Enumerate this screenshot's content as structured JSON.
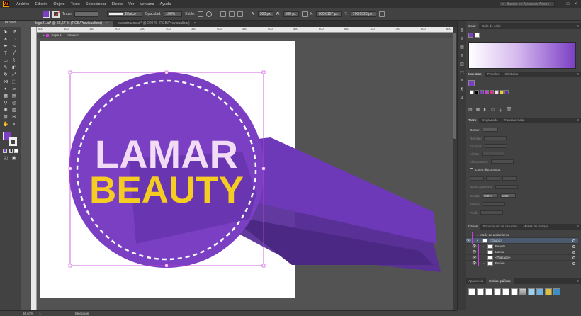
{
  "app": {
    "logo": "Ai"
  },
  "menu": [
    "Archivo",
    "Edición",
    "Objeto",
    "Texto",
    "Seleccionar",
    "Efecto",
    "Ver",
    "Ventana",
    "Ayuda"
  ],
  "search": {
    "placeholder": "Buscar en Ayuda de Adobe"
  },
  "controlbar": {
    "stroke_label": "Trazo",
    "stroke_style": "Básico",
    "opacity_label": "Opacidad:",
    "opacity_value": "100%",
    "style_label": "Estilo:",
    "w_value": "500 px",
    "h_value": "500 px",
    "x_value": "760,0157 px",
    "y_value": "760,0026 px"
  },
  "tabs": [
    {
      "label": "logo21.ai* @ 66,67 % (RGB/Previsualizar)",
      "active": true
    },
    {
      "label": "buscatrazos.ai* @ 200 % (RGB/Previsualizar)",
      "active": false
    }
  ],
  "ruler_ticks": [
    "500",
    "100",
    "150",
    "200",
    "250",
    "300",
    "350",
    "400",
    "450",
    "500",
    "550",
    "600",
    "650",
    "700",
    "750",
    "800",
    "850"
  ],
  "breadcrumb": {
    "layer": "Capa 1",
    "group": "<Grupo>"
  },
  "toolbar": {
    "label": "Trazado"
  },
  "logo": {
    "line1": "LAMAR",
    "line2": "BEAUTY"
  },
  "panels": {
    "color_tabs": [
      "Color",
      "Guía de color"
    ],
    "swatch_tabs": [
      "Muestras",
      "Pinceles",
      "Símbolos"
    ],
    "stroke_tabs": [
      "Trazo",
      "Degradado",
      "Transparencia"
    ],
    "stroke": {
      "weight_label": "Grosor:",
      "cap_label": "Remate:",
      "corner_label": "Esquina:",
      "limit_label": "Límite:",
      "align_label": "Alinear trazo:",
      "dashed_label": "Línea discontinua",
      "start_label": "Punta de flecha:",
      "scale_label": "Escala:",
      "align2_label": "Alinear:",
      "profile_label": "Perfil:",
      "scale_left": "100%",
      "scale_right": "100%"
    },
    "layer_tabs": [
      "Capas",
      "Exportación de recursos",
      "Mesas de trabajo"
    ],
    "layers": [
      {
        "name": "Modo de aislamiento",
        "selected": false
      },
      {
        "name": "<Grupo>",
        "selected": true
      },
      {
        "name": "Beauty",
        "selected": false
      },
      {
        "name": "Lamar",
        "selected": false
      },
      {
        "name": "<Trazado>",
        "selected": false
      },
      {
        "name": "Fusión",
        "selected": false
      }
    ],
    "appearance_tabs": [
      "Apariencia",
      "Estilos gráficos"
    ]
  },
  "status": {
    "zoom": "66,67%",
    "page": "1",
    "tool": "Selección"
  },
  "colors": {
    "purple": "#7b3fc4",
    "yellow": "#f5cc22",
    "shadow": "#5a2f9a",
    "light": "#f2dcf5"
  }
}
